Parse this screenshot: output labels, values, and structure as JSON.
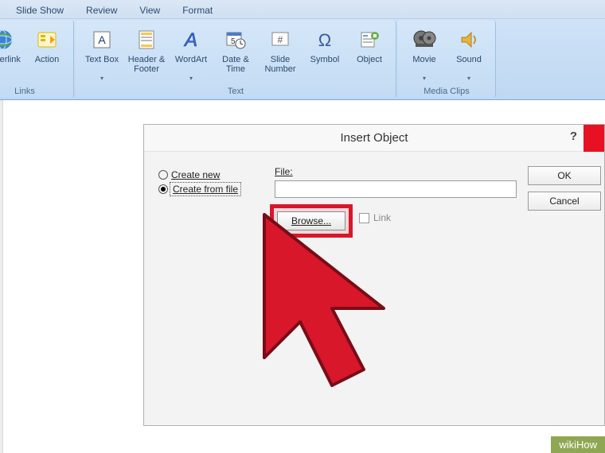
{
  "tabs": {
    "slideshow": "Slide Show",
    "review": "Review",
    "view": "View",
    "format": "Format"
  },
  "ribbon": {
    "links": {
      "label": "Links",
      "hyperlink": "Hyperlink",
      "action": "Action"
    },
    "text": {
      "label": "Text",
      "textbox": "Text Box",
      "headerfooter": "Header & Footer",
      "wordart": "WordArt",
      "datetime": "Date & Time",
      "slidenumber": "Slide Number",
      "symbol": "Symbol",
      "object": "Object"
    },
    "media": {
      "label": "Media Clips",
      "movie": "Movie",
      "sound": "Sound"
    }
  },
  "dialog": {
    "title": "Insert Object",
    "help": "?",
    "create_new": "Create new",
    "create_from_file": "Create from file",
    "file_label": "File:",
    "file_value": "",
    "browse": "Browse...",
    "link": "Link",
    "ok": "OK",
    "cancel": "Cancel"
  },
  "watermark": "wikiHow"
}
